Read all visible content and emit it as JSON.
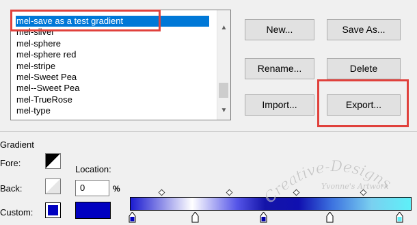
{
  "gradient_list": {
    "items": [
      "mel-save as a test gradient",
      "mel-silver",
      "mel-sphere",
      "mel-sphere red",
      "mel-stripe",
      "mel-Sweet Pea",
      "mel--Sweet Pea",
      "mel-TrueRose",
      "mel-type"
    ],
    "selected_index": 0
  },
  "buttons": {
    "new": "New...",
    "save_as": "Save As...",
    "rename": "Rename...",
    "delete": "Delete",
    "import": "Import...",
    "export": "Export..."
  },
  "gradient_section": {
    "title": "Gradient",
    "fore_label": "Fore:",
    "back_label": "Back:",
    "custom_label": "Custom:",
    "location_label": "Location:",
    "location_value": "0",
    "percent": "%"
  },
  "watermark": {
    "line1": "Creative-Designs",
    "line2": "Yvonne's Artwork"
  },
  "colors": {
    "selection": "#0078d7",
    "highlight_box": "#e0413c",
    "custom_swatch": "#0000c0"
  }
}
